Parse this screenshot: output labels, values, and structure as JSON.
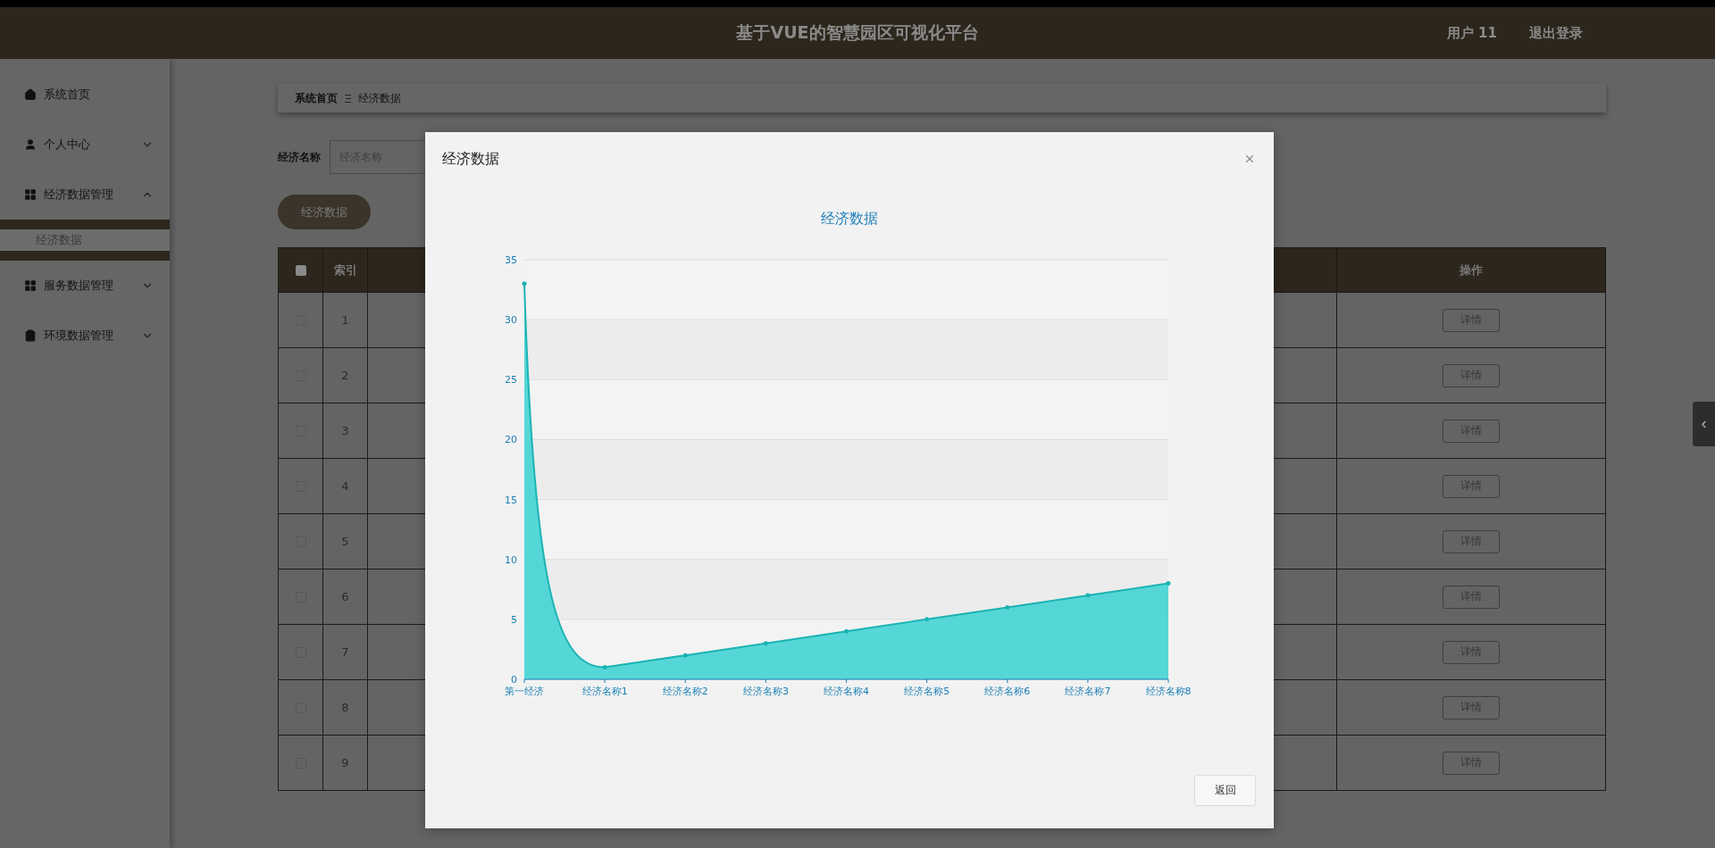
{
  "header": {
    "title": "基于VUE的智慧园区可视化平台",
    "user": "用户 11",
    "logout": "退出登录"
  },
  "sidebar": {
    "items": [
      {
        "kind": "link",
        "label": "系统首页"
      },
      {
        "kind": "menu",
        "label": "个人中心",
        "expanded": false
      },
      {
        "kind": "menu",
        "label": "经济数据管理",
        "expanded": true,
        "children": [
          {
            "label": "经济数据",
            "selected": true
          }
        ]
      },
      {
        "kind": "menu",
        "label": "服务数据管理",
        "expanded": false
      },
      {
        "kind": "menu",
        "label": "环境数据管理",
        "expanded": false
      }
    ]
  },
  "breadcrumb": [
    "系统首页",
    "经济数据"
  ],
  "search": {
    "label": "经济名称",
    "placeholder": "经济名称"
  },
  "primary_button": "经济数据",
  "table": {
    "header_checked": false,
    "columns": [
      "索引",
      "操作"
    ],
    "rows": [
      {
        "checked": false,
        "index": "1",
        "action": "详情"
      },
      {
        "checked": false,
        "index": "2",
        "action": "详情"
      },
      {
        "checked": false,
        "index": "3",
        "action": "详情"
      },
      {
        "checked": false,
        "index": "4",
        "action": "详情"
      },
      {
        "checked": false,
        "index": "5",
        "action": "详情"
      },
      {
        "checked": false,
        "index": "6",
        "action": "详情"
      },
      {
        "checked": false,
        "index": "7",
        "action": "详情"
      },
      {
        "checked": false,
        "index": "8",
        "action": "详情"
      },
      {
        "checked": false,
        "index": "9",
        "action": "详情"
      }
    ]
  },
  "modal": {
    "title": "经济数据",
    "chart_data": {
      "type": "area",
      "title": "经济数据",
      "categories": [
        "第一经济",
        "经济名称1",
        "经济名称2",
        "经济名称3",
        "经济名称4",
        "经济名称5",
        "经济名称6",
        "经济名称7",
        "经济名称8"
      ],
      "series": [
        {
          "color": "#4dd5d5",
          "values": [
            33,
            1,
            2,
            3,
            4,
            5,
            6,
            7,
            8
          ]
        }
      ],
      "grid": true,
      "ylim": [
        0,
        35
      ],
      "yticks": [
        0,
        5,
        10,
        15,
        20,
        25,
        30,
        35
      ]
    },
    "buttons": [
      "返回"
    ]
  }
}
